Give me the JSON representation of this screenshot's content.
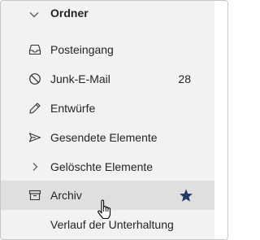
{
  "folders_header": {
    "label": "Ordner",
    "icon": "chevron-down-icon"
  },
  "folders": [
    {
      "label": "Posteingang",
      "icon": "inbox-icon",
      "count": ""
    },
    {
      "label": "Junk-E-Mail",
      "icon": "block-icon",
      "count": "28"
    },
    {
      "label": "Entwürfe",
      "icon": "pencil-icon",
      "count": ""
    },
    {
      "label": "Gesendete Elemente",
      "icon": "send-icon",
      "count": ""
    },
    {
      "label": "Gelöschte Elemente",
      "icon": "chevron-right-icon",
      "count": ""
    },
    {
      "label": "Archiv",
      "icon": "archive-icon",
      "count": "",
      "selected": true,
      "favorite": true
    },
    {
      "label": "Verlauf der Unterhaltung",
      "icon": "",
      "count": ""
    }
  ],
  "colors": {
    "pane": "#f3f2f1",
    "selected": "#e1dfdd",
    "star": "#1b3a6b",
    "text": "#252423"
  }
}
